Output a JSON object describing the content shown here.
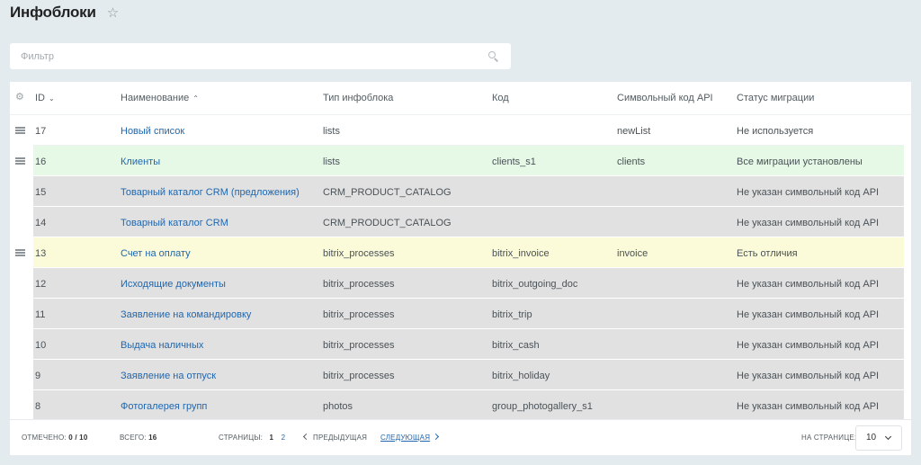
{
  "header": {
    "title": "Инфоблоки",
    "favorite_icon": "star-icon"
  },
  "filter": {
    "placeholder": "Фильтр",
    "icon": "search-icon"
  },
  "colors": {
    "green_row": "#e6f9e7",
    "yellow_row": "#fbfbda",
    "gray_row": "#e1e1e1",
    "link": "#2067b0"
  },
  "columns": {
    "id": "ID",
    "name": "Наименование",
    "type": "Тип инфоблока",
    "code": "Код",
    "api_code": "Символьный код API",
    "status": "Статус миграции"
  },
  "rows": [
    {
      "id": "17",
      "name": "Новый список",
      "type": "lists",
      "code": "",
      "api_code": "newList",
      "status": "Не используется",
      "style": "white"
    },
    {
      "id": "16",
      "name": "Клиенты",
      "type": "lists",
      "code": "clients_s1",
      "api_code": "clients",
      "status": "Все миграции установлены",
      "style": "green"
    },
    {
      "id": "15",
      "name": "Товарный каталог CRM (предложения)",
      "type": "CRM_PRODUCT_CATALOG",
      "code": "",
      "api_code": "",
      "status": "Не указан символьный код API",
      "style": "gray"
    },
    {
      "id": "14",
      "name": "Товарный каталог CRM",
      "type": "CRM_PRODUCT_CATALOG",
      "code": "",
      "api_code": "",
      "status": "Не указан символьный код API",
      "style": "gray"
    },
    {
      "id": "13",
      "name": "Счет на оплату",
      "type": "bitrix_processes",
      "code": "bitrix_invoice",
      "api_code": "invoice",
      "status": "Есть отличия",
      "style": "yellow"
    },
    {
      "id": "12",
      "name": "Исходящие документы",
      "type": "bitrix_processes",
      "code": "bitrix_outgoing_doc",
      "api_code": "",
      "status": "Не указан символьный код API",
      "style": "gray"
    },
    {
      "id": "11",
      "name": "Заявление на командировку",
      "type": "bitrix_processes",
      "code": "bitrix_trip",
      "api_code": "",
      "status": "Не указан символьный код API",
      "style": "gray"
    },
    {
      "id": "10",
      "name": "Выдача наличных",
      "type": "bitrix_processes",
      "code": "bitrix_cash",
      "api_code": "",
      "status": "Не указан символьный код API",
      "style": "gray"
    },
    {
      "id": "9",
      "name": "Заявление на отпуск",
      "type": "bitrix_processes",
      "code": "bitrix_holiday",
      "api_code": "",
      "status": "Не указан символьный код API",
      "style": "gray"
    },
    {
      "id": "8",
      "name": "Фотогалерея групп",
      "type": "photos",
      "code": "group_photogallery_s1",
      "api_code": "",
      "status": "Не указан символьный код API",
      "style": "gray"
    }
  ],
  "footer": {
    "selected_label": "Отмечено:",
    "selected_value": "0 / 10",
    "total_label": "Всего:",
    "total_value": "16",
    "pages_label": "Страницы:",
    "page_current": "1",
    "page_other": "2",
    "prev_label": "Предыдущая",
    "next_label": "Следующая",
    "per_page_label": "На странице:",
    "per_page_value": "10"
  }
}
